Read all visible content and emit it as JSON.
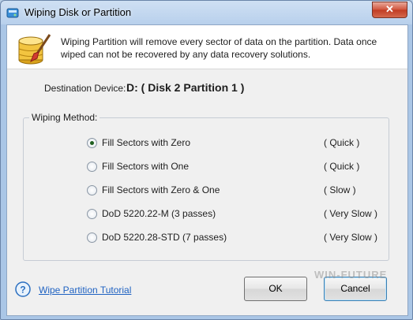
{
  "window": {
    "title": "Wiping Disk or Partition",
    "close_glyph": "✕"
  },
  "header": {
    "message": "Wiping Partition will remove every sector of data on the partition. Data once wiped can not be recovered by any data recovery solutions.",
    "icon": "database-brush-icon"
  },
  "destination": {
    "label": "Destination Device:",
    "value": "D: ( Disk 2 Partition 1 )"
  },
  "wiping_method": {
    "legend": "Wiping Method:",
    "selected": 0,
    "options": [
      {
        "label": "Fill Sectors with Zero",
        "speed": "( Quick )"
      },
      {
        "label": "Fill Sectors with One",
        "speed": "( Quick )"
      },
      {
        "label": "Fill Sectors with Zero & One",
        "speed": "( Slow )"
      },
      {
        "label": "DoD 5220.22-M (3 passes)",
        "speed": "( Very Slow )"
      },
      {
        "label": "DoD 5220.28-STD (7 passes)",
        "speed": "( Very Slow )"
      }
    ]
  },
  "footer": {
    "help_link": "Wipe Partition Tutorial",
    "ok_label": "OK",
    "cancel_label": "Cancel",
    "watermark": "WIN-FUTURE"
  },
  "colors": {
    "link": "#1f62c2",
    "title_bar": "#b8d0ec"
  }
}
